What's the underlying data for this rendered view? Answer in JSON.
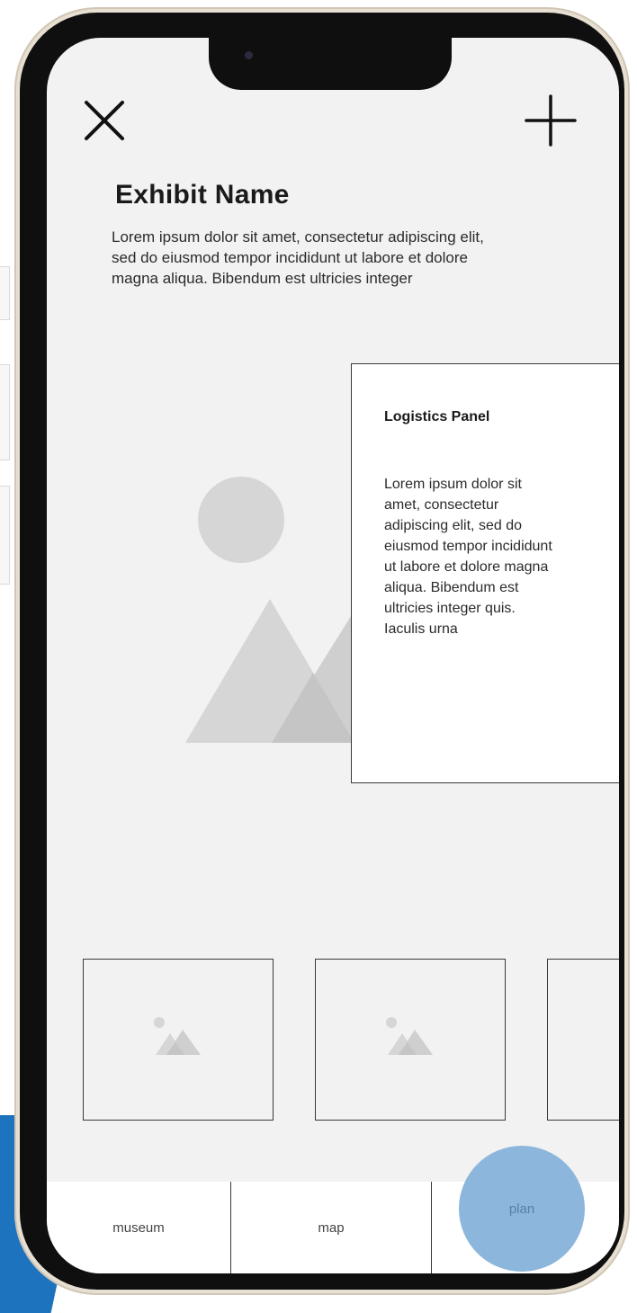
{
  "header": {
    "close_icon": "close-icon",
    "add_icon": "plus-icon"
  },
  "exhibit": {
    "title": "Exhibit Name",
    "description": "Lorem ipsum dolor sit amet, consectetur adipiscing elit, sed do eiusmod tempor incididunt ut labore et dolore magna aliqua. Bibendum est ultricies integer"
  },
  "logistics_panel": {
    "title": "Logistics Panel",
    "body": "Lorem ipsum dolor sit amet, consectetur adipiscing elit, sed do eiusmod tempor incididunt ut labore et dolore magna aliqua. Bibendum est ultricies integer quis. Iaculis urna"
  },
  "thumbnails": [
    "image-placeholder-icon",
    "image-placeholder-icon",
    "image-placeholder-icon"
  ],
  "nav": {
    "items": [
      {
        "label": "museum"
      },
      {
        "label": "map"
      },
      {
        "label": "plan"
      }
    ],
    "active": "plan"
  },
  "colors": {
    "accent": "#8db6dc",
    "corner_blue": "#1e73be",
    "screen_bg": "#f2f2f2",
    "placeholder_gray": "#d6d6d6"
  }
}
